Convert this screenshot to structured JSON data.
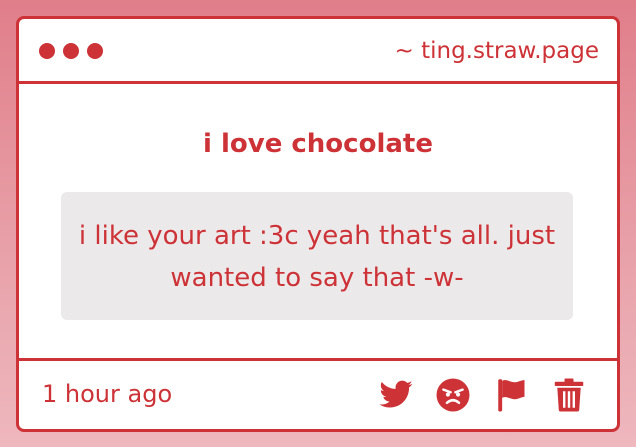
{
  "window": {
    "url": "~ ting.straw.page"
  },
  "post": {
    "question": "i love chocolate",
    "answer": "i like your art :3c yeah that's all. just wanted to say that -w-"
  },
  "footer": {
    "timestamp": "1 hour ago",
    "actions": [
      {
        "icon": "twitter-icon"
      },
      {
        "icon": "angry-face-icon"
      },
      {
        "icon": "flag-icon"
      },
      {
        "icon": "trash-icon"
      }
    ]
  },
  "colors": {
    "accent": "#cd3237",
    "answer_background": "#ebe9ea",
    "page_background": "#e07e8a"
  }
}
